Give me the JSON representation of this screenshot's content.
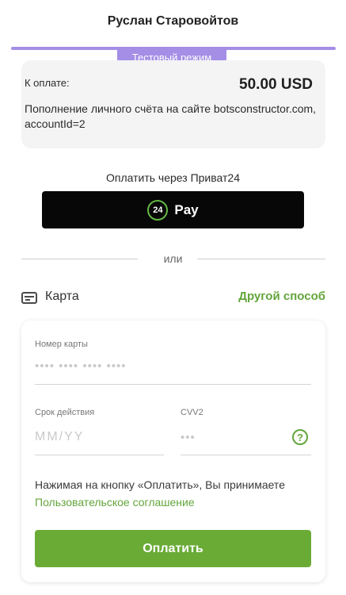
{
  "merchant": {
    "name": "Руслан Старовойтов"
  },
  "test_mode": {
    "label": "Тестовый режим"
  },
  "summary": {
    "pay_label": "К оплате:",
    "amount": "50.00 USD",
    "description": "Пополнение личного счёта на сайте botsconstructor.com, accountId=2"
  },
  "privat": {
    "title": "Оплатить через Приват24",
    "logo_text": "24",
    "button_label": "Pay"
  },
  "divider": {
    "label": "или"
  },
  "card_section": {
    "label": "Карта",
    "icon": "credit-card-icon",
    "other_method_label": "Другой способ"
  },
  "form": {
    "card_number": {
      "label": "Номер карты",
      "placeholder": "•••• •••• •••• ••••"
    },
    "expiry": {
      "label": "Срок действия",
      "placeholder": "ММ/YY"
    },
    "cvv": {
      "label": "CVV2",
      "placeholder": "•••",
      "help_icon": "question-circle-icon",
      "help_text": "?"
    },
    "agreement_text": "Нажимая на кнопку «Оплатить», Вы принимаете ",
    "agreement_link": "Пользовательское соглашение",
    "submit_label": "Оплатить"
  },
  "colors": {
    "accent_green": "#6aab36",
    "test_mode_purple": "#a48ee6",
    "pay_button_black": "#070707"
  }
}
